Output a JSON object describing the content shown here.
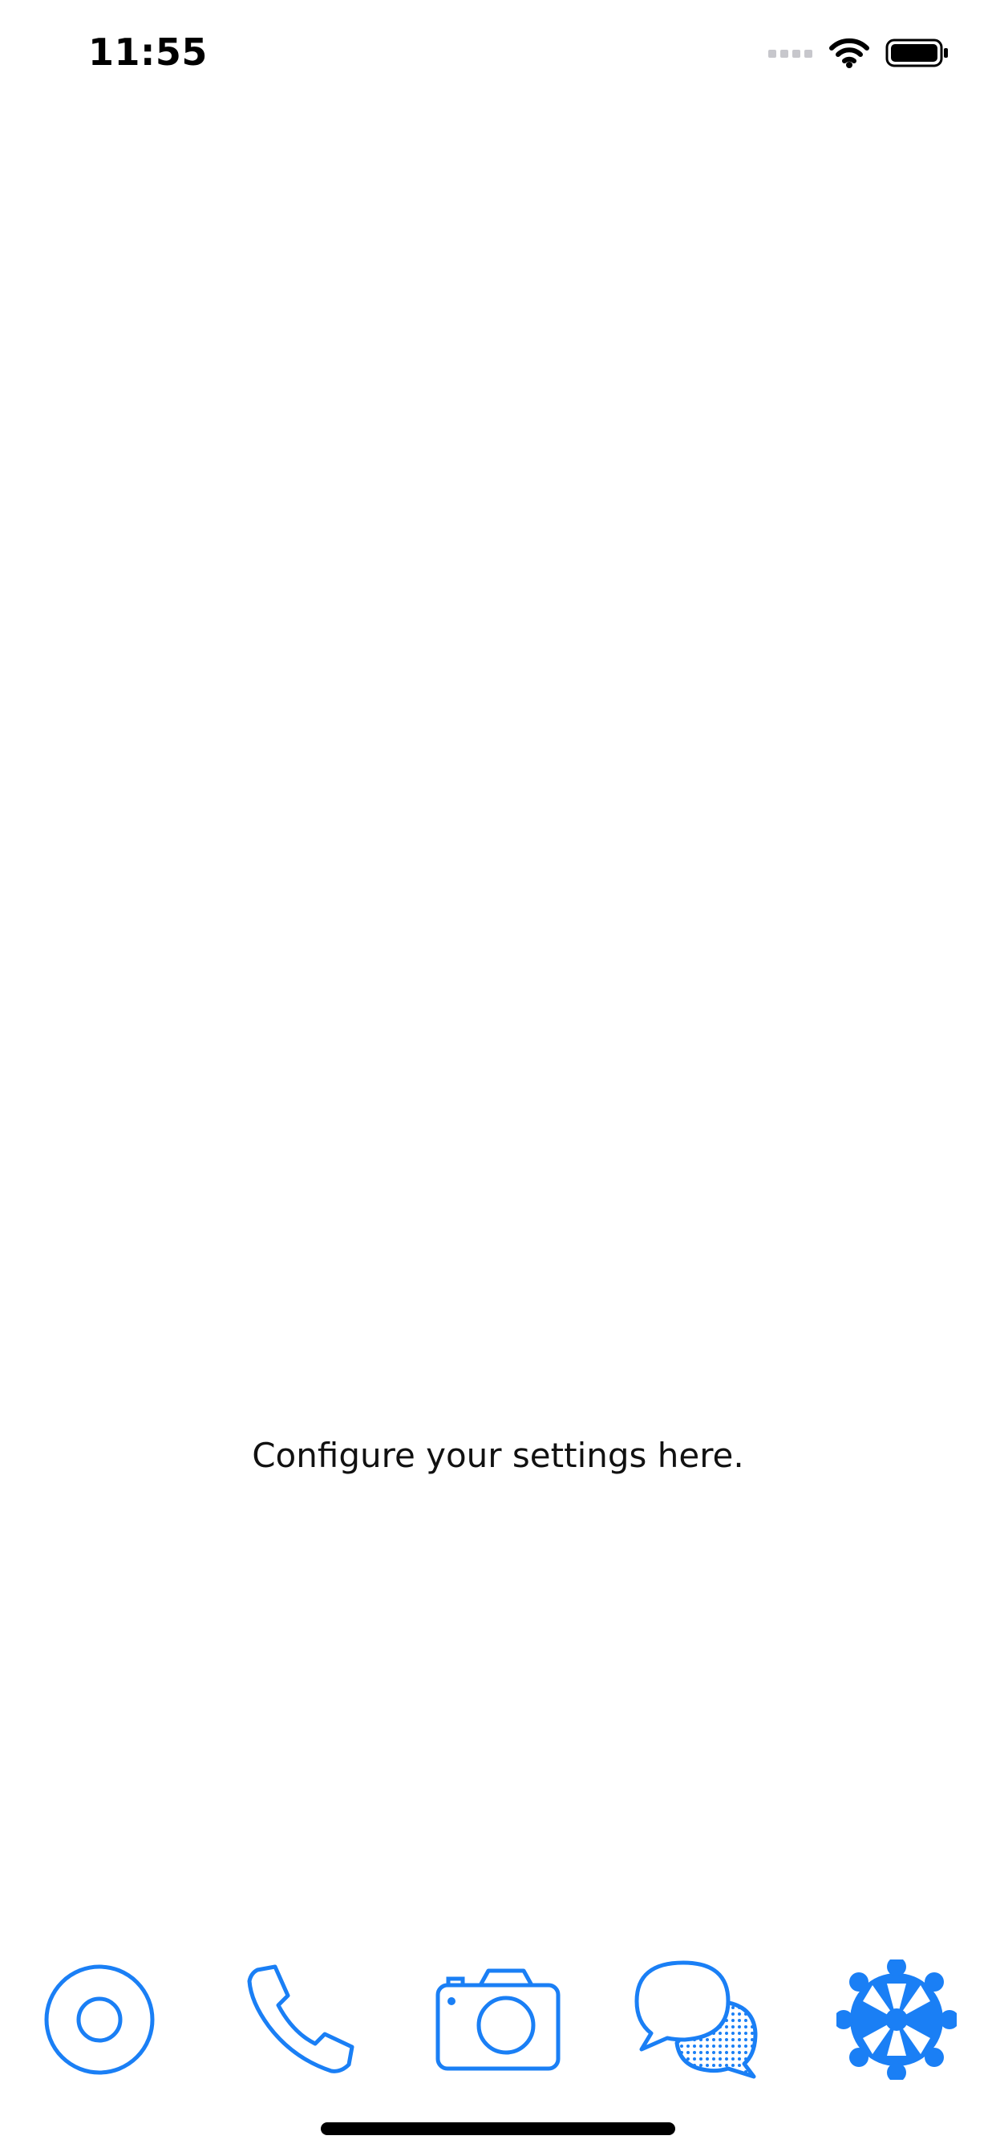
{
  "status_bar": {
    "time": "11:55",
    "signal_icon": "signal-bars-icon",
    "wifi_icon": "wifi-icon",
    "battery_icon": "battery-icon"
  },
  "main": {
    "message": "Configure your settings here."
  },
  "tab_bar": {
    "accent_color": "#1A7FF5",
    "selected_index": 4,
    "tabs": [
      {
        "icon": "record-icon"
      },
      {
        "icon": "phone-icon"
      },
      {
        "icon": "camera-icon"
      },
      {
        "icon": "chat-bubbles-icon"
      },
      {
        "icon": "gear-icon"
      }
    ]
  }
}
